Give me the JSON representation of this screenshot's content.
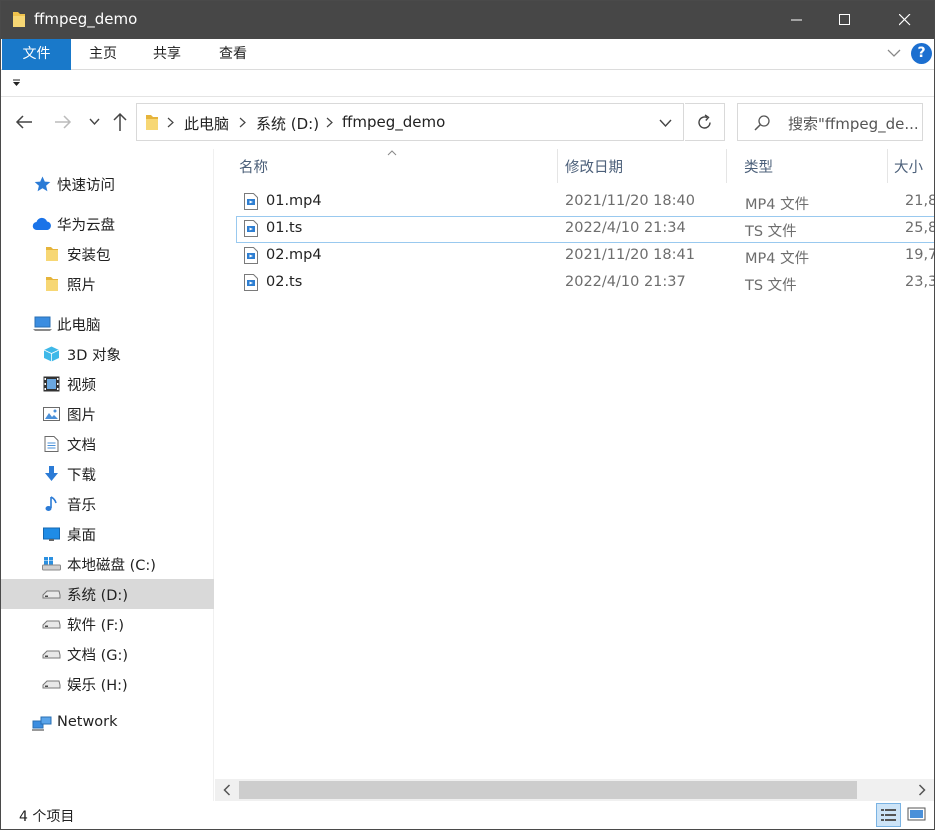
{
  "window": {
    "title": "ffmpeg_demo"
  },
  "ribbon": {
    "tabs": [
      "文件",
      "主页",
      "共享",
      "查看"
    ]
  },
  "address": {
    "crumbs": [
      "此电脑",
      "系统 (D:)",
      "ffmpeg_demo"
    ]
  },
  "search": {
    "placeholder": "搜索\"ffmpeg_de..."
  },
  "sidebar": {
    "items": [
      {
        "label": "快速访问",
        "icon": "star-icon"
      },
      {
        "label": "华为云盘",
        "icon": "cloud-icon"
      },
      {
        "label": "安装包",
        "icon": "folder-icon"
      },
      {
        "label": "照片",
        "icon": "folder-icon"
      },
      {
        "label": "此电脑",
        "icon": "computer-icon"
      },
      {
        "label": "3D 对象",
        "icon": "cube-icon"
      },
      {
        "label": "视频",
        "icon": "film-icon"
      },
      {
        "label": "图片",
        "icon": "picture-icon"
      },
      {
        "label": "文档",
        "icon": "document-icon"
      },
      {
        "label": "下载",
        "icon": "download-icon"
      },
      {
        "label": "音乐",
        "icon": "music-icon"
      },
      {
        "label": "桌面",
        "icon": "desktop-icon"
      },
      {
        "label": "本地磁盘 (C:)",
        "icon": "windows-drive-icon"
      },
      {
        "label": "系统 (D:)",
        "icon": "drive-icon",
        "selected": true
      },
      {
        "label": "软件 (F:)",
        "icon": "drive-icon"
      },
      {
        "label": "文档 (G:)",
        "icon": "drive-icon"
      },
      {
        "label": "娱乐 (H:)",
        "icon": "drive-icon"
      },
      {
        "label": "Network",
        "icon": "network-icon"
      }
    ]
  },
  "filelist": {
    "columns": [
      "名称",
      "修改日期",
      "类型",
      "大小"
    ],
    "rows": [
      {
        "name": "01.mp4",
        "date": "2021/11/20 18:40",
        "type": "MP4 文件",
        "size": "21,8"
      },
      {
        "name": "01.ts",
        "date": "2022/4/10 21:34",
        "type": "TS 文件",
        "size": "25,8"
      },
      {
        "name": "02.mp4",
        "date": "2021/11/20 18:41",
        "type": "MP4 文件",
        "size": "19,7"
      },
      {
        "name": "02.ts",
        "date": "2022/4/10 21:37",
        "type": "TS 文件",
        "size": "23,3"
      }
    ]
  },
  "status": {
    "count": "4 个项目"
  },
  "colors": {
    "accent": "#1979ca",
    "titlebar": "#474747",
    "selection": "#d9d9d9"
  }
}
